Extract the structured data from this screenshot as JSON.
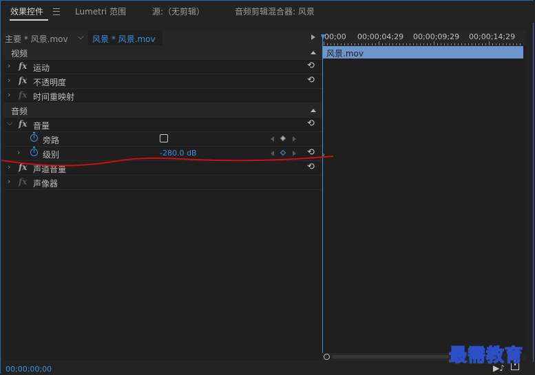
{
  "tabs": [
    {
      "label": "效果控件",
      "active": true
    },
    {
      "label": "Lumetri 范围",
      "active": false
    },
    {
      "label": "源:（无剪辑）",
      "active": false
    },
    {
      "label": "音频剪辑混合器: 风景",
      "active": false
    }
  ],
  "clip_header": {
    "master": "主要 * 风景.mov",
    "sequence": "风景 * 风景.mov"
  },
  "sections": {
    "video": "视频",
    "audio": "音频"
  },
  "effects": {
    "motion": "运动",
    "opacity": "不透明度",
    "time_remap": "时间重映射",
    "volume": "音量",
    "bypass": "旁路",
    "level": "级别",
    "level_value": "-280.0 dB",
    "channel_volume": "声道音量",
    "panner": "声像器",
    "fx_symbol": "fx"
  },
  "timeline": {
    "timecodes": [
      "00;00",
      "00;00;04;29",
      "00;00;09;29",
      "00;00;14;29"
    ],
    "clip_name": "风景.mov"
  },
  "footer": {
    "timecode": "00;00;00;00"
  },
  "watermark": "最需教育",
  "icons": {
    "reset": "reset-icon",
    "stopwatch": "stopwatch-icon",
    "menu": "hamburger-menu-icon",
    "play": "play-triangle-icon"
  },
  "colors": {
    "accent": "#3d8fe0",
    "clip": "#6d97cc",
    "annotation": "#cc1111"
  }
}
